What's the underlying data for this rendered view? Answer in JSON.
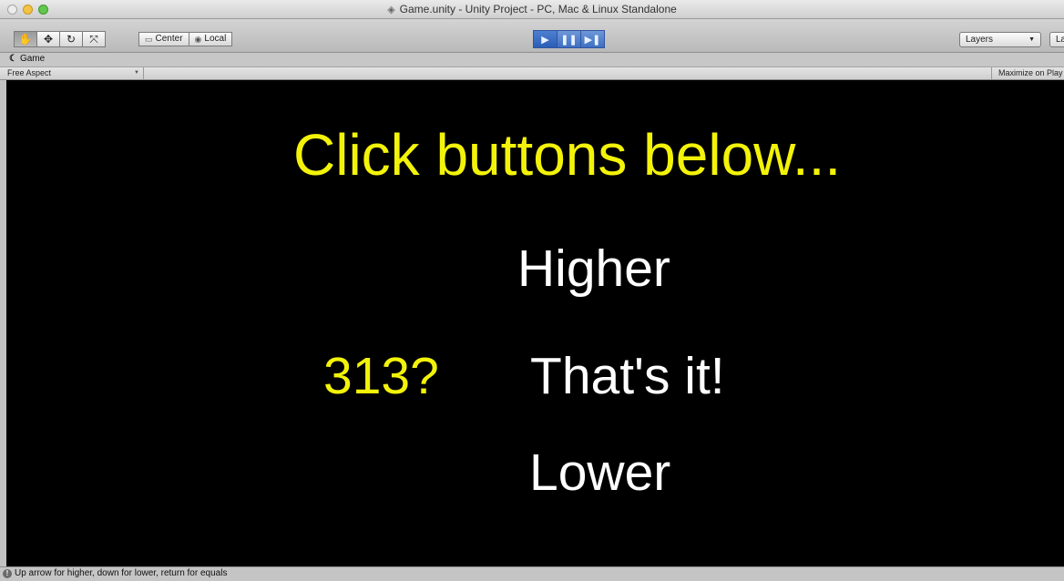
{
  "window": {
    "title": "Game.unity - Unity Project - PC, Mac & Linux Standalone"
  },
  "toolbar": {
    "tools": [
      {
        "name": "hand-tool-button",
        "icon": "hand-icon",
        "glyph": "✋"
      },
      {
        "name": "move-tool-button",
        "icon": "move-icon",
        "glyph": "✥"
      },
      {
        "name": "rotate-tool-button",
        "icon": "rotate-icon",
        "glyph": "↻"
      },
      {
        "name": "scale-tool-button",
        "icon": "scale-icon",
        "glyph": "⤧"
      }
    ],
    "pivot_label": "Center",
    "space_label": "Local",
    "play_icon": "play-icon",
    "pause_icon": "pause-icon",
    "step_icon": "step-icon",
    "layers_label": "Layers",
    "layout_label": "La"
  },
  "game_tab": {
    "label": "Game"
  },
  "game_toolbar": {
    "aspect_label": "Free Aspect",
    "maximize_label": "Maximize on Play"
  },
  "game": {
    "heading": "Click buttons below...",
    "higher_label": "Higher",
    "guess_label": "313?",
    "equal_label": "That's it!",
    "lower_label": "Lower"
  },
  "status": {
    "message": "Up arrow for higher, down for lower, return for equals"
  },
  "colors": {
    "game_yellow": "#f3f309",
    "game_white": "#ffffff",
    "play_blue": "#3f6fc1"
  }
}
